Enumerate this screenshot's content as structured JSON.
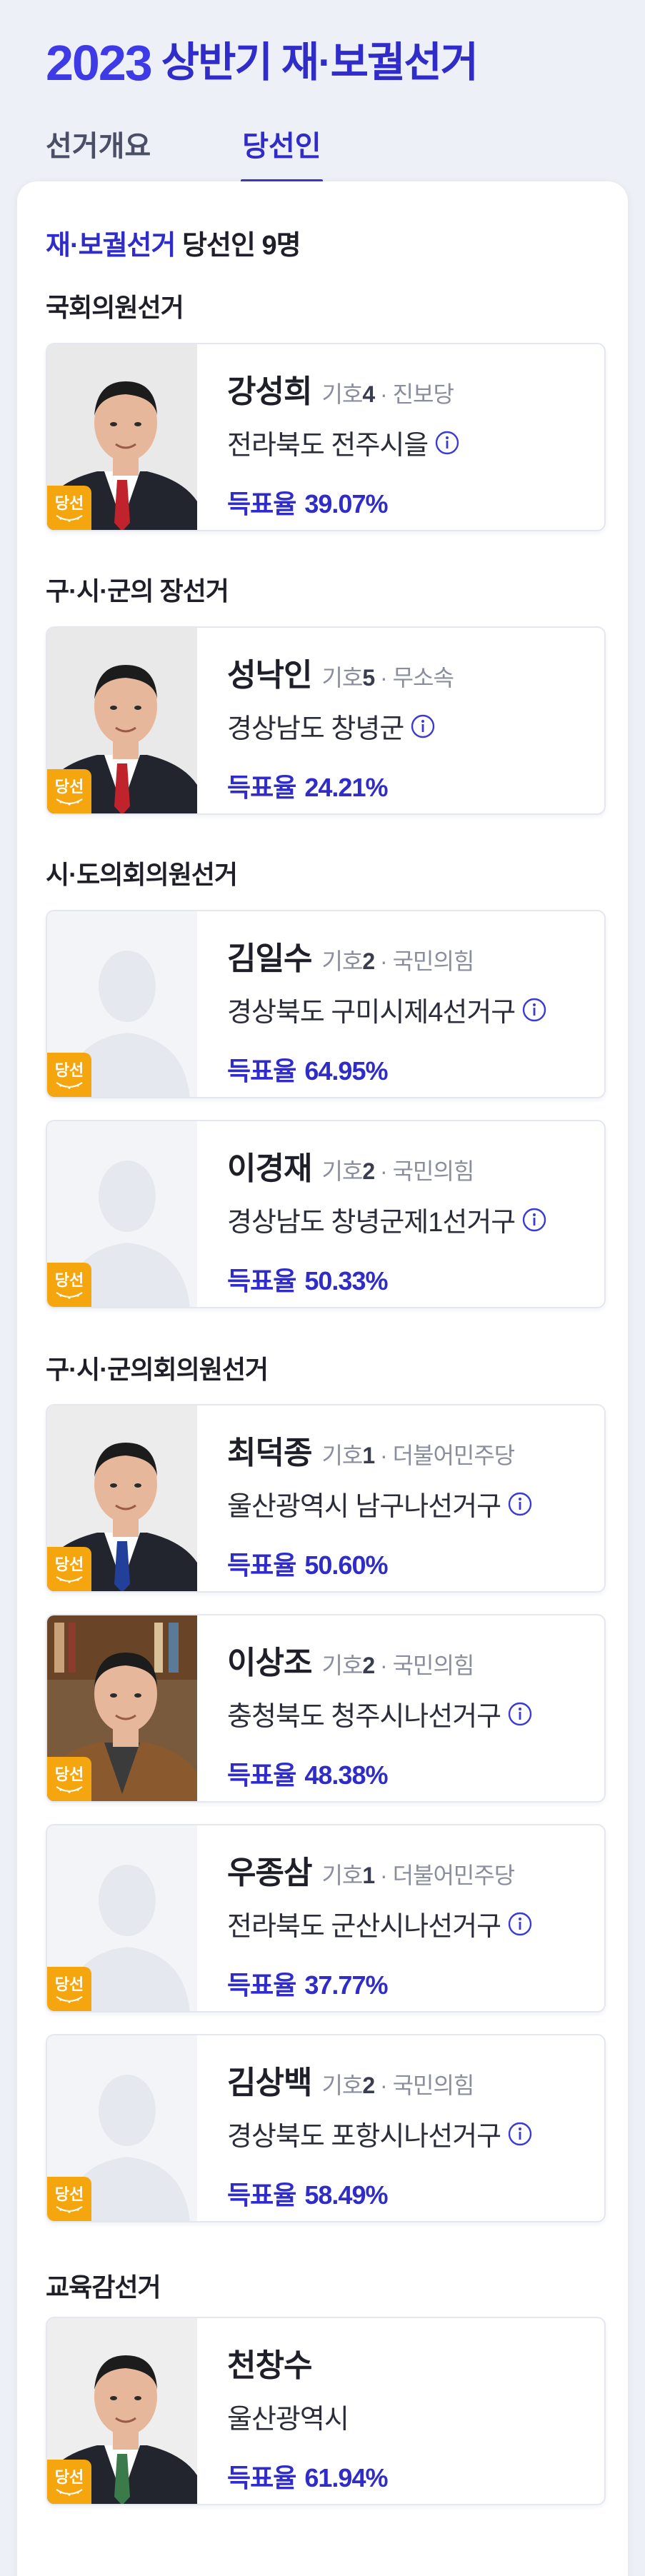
{
  "header": {
    "year": "2023",
    "title": "상반기 재·보궐선거"
  },
  "tabs": [
    {
      "label": "선거개요",
      "active": false
    },
    {
      "label": "당선인",
      "active": true
    }
  ],
  "summary": {
    "highlight": "재·보궐선거",
    "rest": "당선인 9명"
  },
  "badge_label": "당선",
  "rate_label": "득표율",
  "sections": [
    {
      "title": "국회의원선거"
    },
    {
      "title": "구·시·군의 장선거"
    },
    {
      "title": "시·도의회의원선거"
    },
    {
      "title": "구·시·군의회의원선거"
    },
    {
      "title": "교육감선거"
    }
  ],
  "winners": [
    {
      "name": "강성희",
      "num_label": "기호",
      "num": "4",
      "party": "진보당",
      "district": "전라북도 전주시을",
      "rate": "39.07%",
      "photo": "person-red-tie"
    },
    {
      "name": "성낙인",
      "num_label": "기호",
      "num": "5",
      "party": "무소속",
      "district": "경상남도 창녕군",
      "rate": "24.21%",
      "photo": "person-red-tie"
    },
    {
      "name": "김일수",
      "num_label": "기호",
      "num": "2",
      "party": "국민의힘",
      "district": "경상북도 구미시제4선거구",
      "rate": "64.95%",
      "photo": "placeholder-silhouette"
    },
    {
      "name": "이경재",
      "num_label": "기호",
      "num": "2",
      "party": "국민의힘",
      "district": "경상남도 창녕군제1선거구",
      "rate": "50.33%",
      "photo": "placeholder-silhouette"
    },
    {
      "name": "최덕종",
      "num_label": "기호",
      "num": "1",
      "party": "더불어민주당",
      "district": "울산광역시 남구나선거구",
      "rate": "50.60%",
      "photo": "person-blue-tie"
    },
    {
      "name": "이상조",
      "num_label": "기호",
      "num": "2",
      "party": "국민의힘",
      "district": "충청북도 청주시나선거구",
      "rate": "48.38%",
      "photo": "person-brown-jacket"
    },
    {
      "name": "우종삼",
      "num_label": "기호",
      "num": "1",
      "party": "더불어민주당",
      "district": "전라북도 군산시나선거구",
      "rate": "37.77%",
      "photo": "placeholder-silhouette"
    },
    {
      "name": "김상백",
      "num_label": "기호",
      "num": "2",
      "party": "국민의힘",
      "district": "경상북도 포항시나선거구",
      "rate": "58.49%",
      "photo": "placeholder-silhouette"
    },
    {
      "name": "천창수",
      "district": "울산광역시",
      "rate": "61.94%",
      "photo": "person-green-tie"
    }
  ],
  "colors": {
    "accent": "#2f2cc9",
    "badge": "#f5a50d",
    "background": "#eef0f7"
  }
}
